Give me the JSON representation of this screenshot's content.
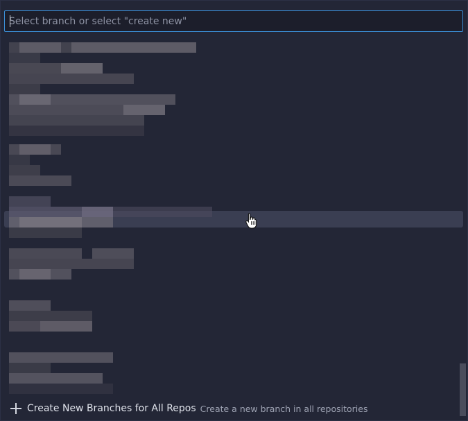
{
  "search": {
    "placeholder": "Select branch or select \"create new\"",
    "value": ""
  },
  "footer": {
    "label": "Create New Branches for All Repos",
    "description": "Create a new branch in all repositories"
  },
  "icons": {
    "create": "plus-icon",
    "pointer": "hand-cursor-icon"
  },
  "colors": {
    "focus_border": "#3b8ed6",
    "hover_row": "#3a3e52",
    "background": "#232636"
  }
}
